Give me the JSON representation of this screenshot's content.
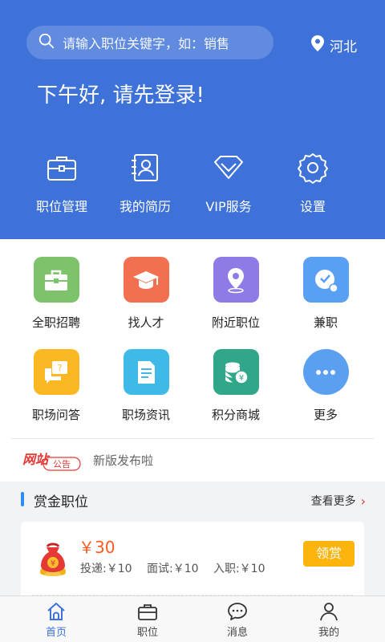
{
  "search": {
    "placeholder": "请输入职位关键字，如：销售"
  },
  "location": "河北",
  "greeting": "下午好, 请先登录!",
  "quick_actions": [
    {
      "label": "职位管理",
      "icon": "briefcase-icon"
    },
    {
      "label": "我的简历",
      "icon": "resume-icon"
    },
    {
      "label": "VIP服务",
      "icon": "diamond-icon"
    },
    {
      "label": "设置",
      "icon": "gear-icon"
    }
  ],
  "grid": [
    {
      "label": "全职招聘",
      "icon": "briefcase-icon",
      "color": "#7cc36b"
    },
    {
      "label": "找人才",
      "icon": "graduation-cap-icon",
      "color": "#f2704f"
    },
    {
      "label": "附近职位",
      "icon": "location-pin-icon",
      "color": "#8f7ae6"
    },
    {
      "label": "兼职",
      "icon": "clock-icon",
      "color": "#5aa0f2"
    },
    {
      "label": "职场问答",
      "icon": "qa-bubble-icon",
      "color": "#fcb823"
    },
    {
      "label": "职场资讯",
      "icon": "document-icon",
      "color": "#3fb9e8"
    },
    {
      "label": "积分商城",
      "icon": "coins-icon",
      "color": "#2fa788"
    },
    {
      "label": "更多",
      "icon": "more-icon",
      "color": "#5b9ff0"
    }
  ],
  "notice": {
    "badge_main": "网站",
    "badge_sub": "公告",
    "text": "新版发布啦"
  },
  "reward_section": {
    "title": "赏金职位",
    "more": "查看更多"
  },
  "reward_card": {
    "price": "￥30",
    "deliver": "投递:￥10",
    "interview": "面试:￥10",
    "onboard": "入职:￥10",
    "claim": "领赏",
    "bag_symbol": "¥"
  },
  "tabs": [
    {
      "label": "首页",
      "icon": "home-icon",
      "active": true
    },
    {
      "label": "职位",
      "icon": "briefcase-icon",
      "active": false
    },
    {
      "label": "消息",
      "icon": "message-icon",
      "active": false
    },
    {
      "label": "我的",
      "icon": "user-icon",
      "active": false
    }
  ],
  "colors": {
    "header": "#3e72d8",
    "accent_orange": "#ff5a1f",
    "claim_button": "#fdb50e",
    "section_bar": "#2b8ef0"
  }
}
